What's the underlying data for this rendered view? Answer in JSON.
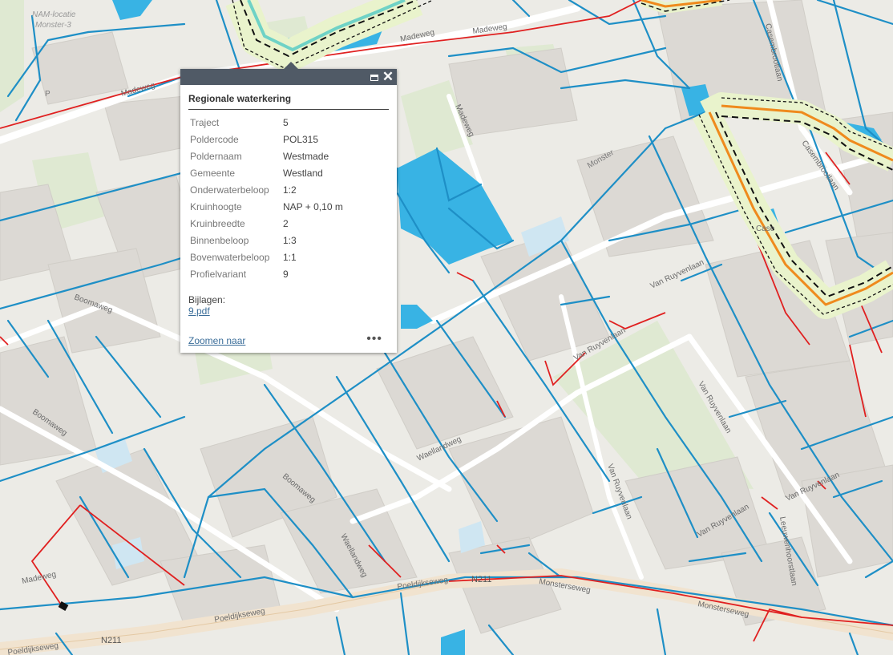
{
  "map": {
    "labels": {
      "nam": [
        "NAM-locatie",
        "Monster-3"
      ],
      "madeweg_1": "Madeweg",
      "madeweg_2": "Madeweg",
      "madeweg_3": "Madeweg",
      "madeweg_4": "Madeweg",
      "monster": "Monster",
      "casembrootlaan_1": "Casembrootlaan",
      "casembrootlaan_2": "Casembrootlaan",
      "casembrootlaan_3": "Case",
      "boomaweg_1": "Boomaweg",
      "boomaweg_2": "Boomaweg",
      "boomaweg_3": "Boomaweg",
      "vanruyvenlaan_1": "Van Ruyvenlaan",
      "vanruyvenlaan_2": "Van Ruyvenlaan",
      "vanruyvenlaan_3": "Van Ruyvenlaan",
      "vanruyvenlaan_4": "Van Ruyvenlaan",
      "vanruyvenlaan_5": "Van Ruyvenlaan",
      "vanruyvenlaan_6": "Van Ruyvenlaan",
      "waellandweg_1": "Waellandweg",
      "waellandweg_2": "Waellandweg",
      "leeuwenhoorstlaan": "Leeuwenhoorstlaan",
      "n211_1": "N211",
      "n211_2": "N211",
      "monsterseweg_1": "Monsterseweg",
      "monsterseweg_2": "Monsterseweg",
      "poeldijkseweg_1": "Poeldijkseweg",
      "poeldijkseweg_2": "Poeldijkseweg",
      "poeldijkseweg_3": "Poeldijkseweg",
      "madeweg_bottom": "Madeweg",
      "parking": "P"
    },
    "colors": {
      "water": "#38b3e4",
      "ditch": "#1e8fc6",
      "boundary": "#e02020",
      "building": "#dcd9d4",
      "greenhouse": "#e3e1dc",
      "green": "#dfe9d2",
      "road": "#ffffff",
      "levee_fill": "#e9f3cc",
      "levee_orange": "#ef8a1d"
    }
  },
  "popup": {
    "title": "Regionale waterkering",
    "rows": [
      {
        "key": "Traject",
        "value": "5"
      },
      {
        "key": "Poldercode",
        "value": "POL315"
      },
      {
        "key": "Poldernaam",
        "value": "Westmade"
      },
      {
        "key": "Gemeente",
        "value": "Westland"
      },
      {
        "key": "Onderwaterbeloop",
        "value": "1:2"
      },
      {
        "key": "Kruinhoogte",
        "value": "NAP + 0,10 m"
      },
      {
        "key": "Kruinbreedte",
        "value": "2"
      },
      {
        "key": "Binnenbeloop",
        "value": "1:3"
      },
      {
        "key": "Bovenwaterbeloop",
        "value": "1:1"
      },
      {
        "key": "Profielvariant",
        "value": "9"
      }
    ],
    "attachments_label": "Bijlagen:",
    "attachment_link": "9.pdf",
    "zoom_link": "Zoomen naar",
    "more_label": "•••",
    "close_label": "✕"
  }
}
